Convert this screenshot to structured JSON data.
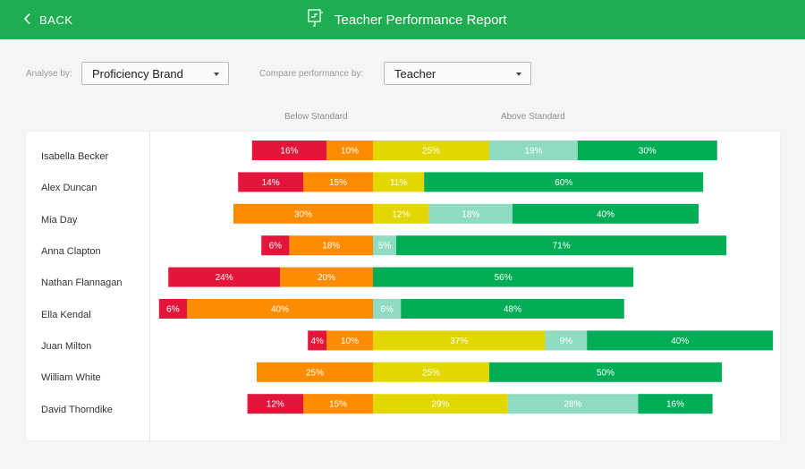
{
  "header": {
    "back_label": "BACK",
    "title": "Teacher Performance Report"
  },
  "controls": {
    "analyse_label": "Analyse by:",
    "analyse_value": "Proficiency Brand",
    "compare_label": "Compare performance by:",
    "compare_value": "Teacher"
  },
  "colors": {
    "header_bg": "#1fad52",
    "band_1": "#e3153b",
    "band_2": "#ff8c00",
    "band_3": "#e2d800",
    "band_4": "#8fdcc2",
    "band_5": "#00ad57"
  },
  "chart_data": {
    "type": "bar",
    "orientation": "horizontal",
    "stacked": "diverging",
    "group_labels": [
      "Below Standard",
      "Above Standard"
    ],
    "categories": [
      "Isabella Becker",
      "Alex Duncan",
      "Mia Day",
      "Anna Clapton",
      "Nathan Flannagan",
      "Ella Kendal",
      "Juan Milton",
      "William White",
      "David Thorndike"
    ],
    "series": [
      {
        "values": [
          16,
          14,
          0,
          6,
          24,
          6,
          4,
          0,
          12
        ],
        "side": "below",
        "color": "#e3153b"
      },
      {
        "values": [
          10,
          15,
          30,
          18,
          20,
          40,
          10,
          25,
          15
        ],
        "side": "below",
        "color": "#ff8c00"
      },
      {
        "values": [
          25,
          11,
          12,
          0,
          0,
          0,
          37,
          25,
          29
        ],
        "side": "above",
        "color": "#e2d800"
      },
      {
        "values": [
          19,
          0,
          18,
          5,
          0,
          6,
          9,
          0,
          28
        ],
        "side": "above",
        "color": "#8fdcc2"
      },
      {
        "values": [
          30,
          60,
          40,
          71,
          56,
          48,
          40,
          50,
          16
        ],
        "side": "above",
        "color": "#00ad57"
      }
    ],
    "value_suffix": "%"
  }
}
